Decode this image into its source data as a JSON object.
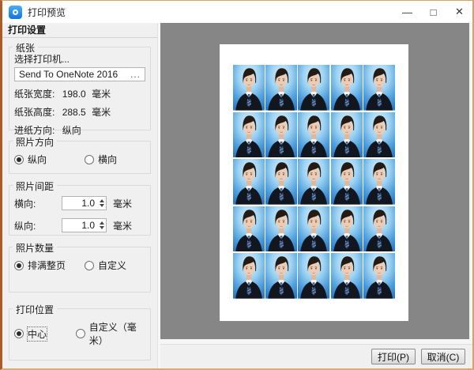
{
  "window": {
    "title": "打印预览",
    "controls": {
      "minimize": "—",
      "maximize": "□",
      "close": "✕"
    }
  },
  "panel": {
    "header": "打印设置",
    "paper": {
      "group_label": "纸张",
      "select_printer_label": "选择打印机...",
      "printer_name": "Send To OneNote 2016",
      "browse_label": "...",
      "width_label": "纸张宽度:",
      "width_value": "198.0",
      "height_label": "纸张高度:",
      "height_value": "288.5",
      "feed_label": "进纸方向:",
      "feed_value": "纵向",
      "unit": "毫米"
    },
    "photo_orientation": {
      "group_label": "照片方向",
      "portrait_label": "纵向",
      "landscape_label": "横向",
      "selected": "portrait"
    },
    "photo_spacing": {
      "group_label": "照片间距",
      "horizontal_label": "横向:",
      "horizontal_value": "1.0",
      "vertical_label": "纵向:",
      "vertical_value": "1.0",
      "unit": "毫米"
    },
    "photo_quantity": {
      "group_label": "照片数量",
      "fill_page_label": "排满整页",
      "custom_label": "自定义",
      "selected": "fill_page"
    },
    "print_position": {
      "group_label": "打印位置",
      "center_label": "中心",
      "custom_label": "自定义（毫米）",
      "selected": "center"
    }
  },
  "preview": {
    "grid_rows": 5,
    "grid_cols": 5,
    "photo_description": "蓝底证件照"
  },
  "footer": {
    "print_label": "打印(P)",
    "cancel_label": "取消(C)"
  },
  "colors": {
    "window_border": "#ab5a28",
    "preview_bg": "#868686",
    "photo_bg_light": "#dbf1fc",
    "photo_bg_dark": "#2a78c2",
    "suit": "#12161f",
    "tie": "#31527f"
  }
}
